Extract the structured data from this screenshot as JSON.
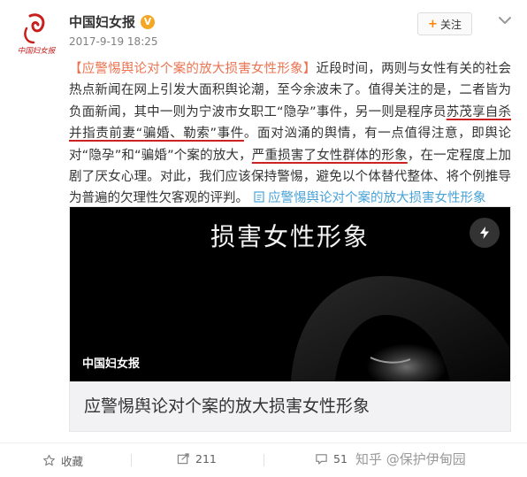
{
  "header": {
    "avatar_text": "中国妇女报",
    "username": "中国妇女报",
    "verified_badge": "V",
    "timestamp": "2017-9-19 18:25",
    "follow_label": "关注",
    "follow_icon": "plus-icon",
    "more_icon": "chevron-down-icon"
  },
  "body": {
    "title": "【应警惕舆论对个案的放大损害女性形象】",
    "p1": "近段时间，两则与女性有关的社会热点新闻在网上引发大面积舆论潮，至今余波未了。值得关注的是，二者皆为负面新闻，其中一则为宁波市女职工“隐孕”事件，另一则是程序员",
    "u1": "苏茂享自杀并指责前妻“骗婚、勒索”事件",
    "p2": "。面对汹涌的舆情，有一点值得注意，即舆论对“隐孕”和“骗婚”个案的放大，",
    "u2": "严重损害了女性群体的形象",
    "p3": "，在一定程度上加剧了厌女心理。对此，我们应该保持警惕，避免以个体替代整体、将个例推导为普遍的欠理性欠客观的评判。",
    "link_label": "应警惕舆论对个案的放大损害女性形象",
    "link_icon": "document-icon"
  },
  "card": {
    "image_title": "损害女性形象",
    "image_source": "中国妇女报",
    "badge_icon": "lightning-icon",
    "title": "应警惕舆论对个案的放大损害女性形象"
  },
  "footer": {
    "favorite_label": "收藏",
    "forward_count": "211",
    "comment_count": "51",
    "watermark": "知乎 @保护伊甸园",
    "favorite_icon": "star-icon",
    "forward_icon": "forward-icon",
    "comment_icon": "comment-icon"
  },
  "colors": {
    "accent": "#eb7350",
    "link": "#4aa3d8",
    "underline": "#cc2222",
    "follow_plus": "#ff8200"
  }
}
